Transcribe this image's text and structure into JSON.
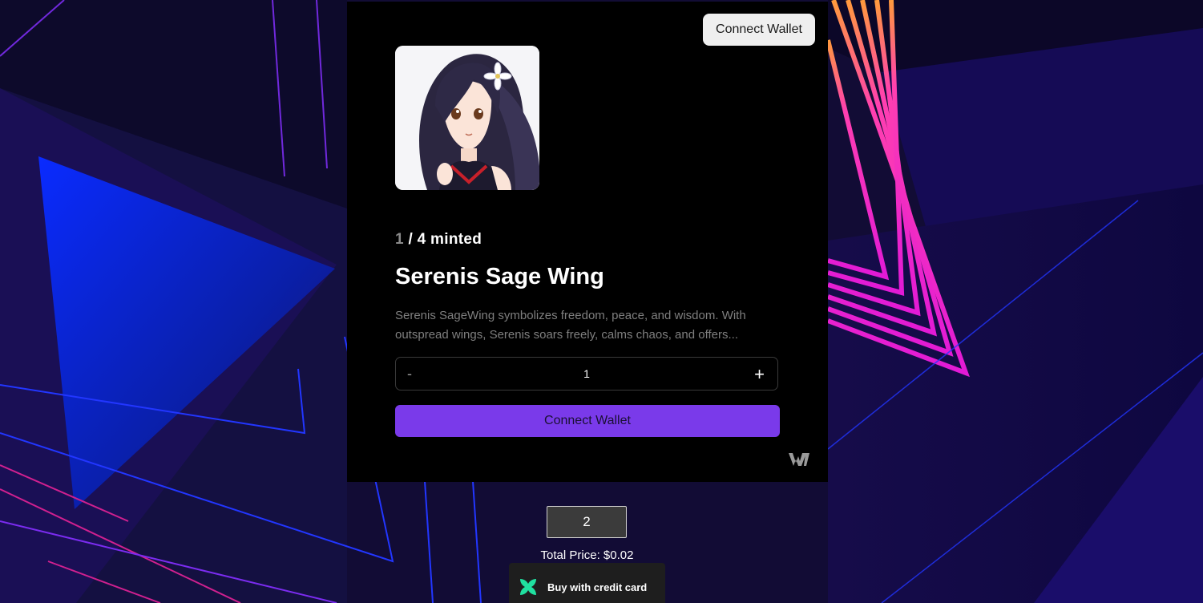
{
  "header": {
    "connect_label": "Connect Wallet"
  },
  "nft": {
    "image_alt": "anime girl with flower hair clip",
    "minted_count": "1",
    "minted_suffix": " / 4 minted",
    "title": "Serenis Sage Wing",
    "description": "Serenis SageWing symbolizes freedom, peace, and wisdom. With outspread wings, Serenis soars freely, calms chaos, and offers..."
  },
  "quantity": {
    "minus": "-",
    "value": "1",
    "plus": "+"
  },
  "mint": {
    "label": "Connect Wallet"
  },
  "purchase": {
    "quantity": "2",
    "total_price": "Total Price: $0.02",
    "credit_card_label": "Buy with credit card"
  },
  "colors": {
    "accent": "#7a3aea",
    "card_bg": "#000000",
    "page_bg": "#0e0a2a"
  },
  "icons": {
    "brand": "thirdweb-logo-icon",
    "credit_card": "crossmint-icon"
  }
}
